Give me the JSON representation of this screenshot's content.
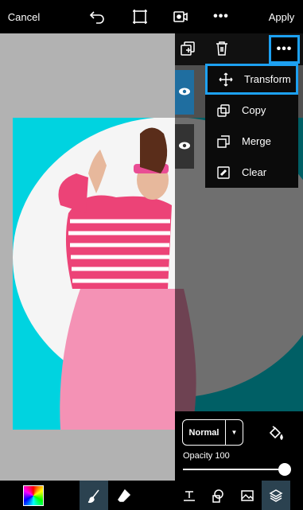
{
  "topbar": {
    "cancel_label": "Cancel",
    "apply_label": "Apply",
    "icons": [
      "undo-icon",
      "crop-icon",
      "video-record-icon",
      "more-horizontal-icon"
    ]
  },
  "layer_panel": {
    "toolbar_icons": [
      "duplicate-layer-icon",
      "delete-layer-icon",
      "more-icon"
    ],
    "menu": {
      "items": [
        {
          "label": "Transform",
          "icon": "transform-arrows-icon",
          "active": true
        },
        {
          "label": "Copy",
          "icon": "copy-icon",
          "active": false
        },
        {
          "label": "Merge",
          "icon": "merge-icon",
          "active": false
        },
        {
          "label": "Clear",
          "icon": "eraser-clear-icon",
          "active": false
        }
      ]
    },
    "blend_mode": "Normal",
    "opacity_label": "Opacity 100",
    "opacity_value": 100
  },
  "bottombar": {
    "tools": [
      "color-palette",
      "brush-icon",
      "eraser-icon",
      "text-icon",
      "shape-icon",
      "image-icon",
      "layers-icon"
    ],
    "selected_tool": "brush-icon",
    "selected_tab": "layers-icon"
  },
  "colors": {
    "accent": "#1da1f2",
    "canvas_bg": "#b2b2b2",
    "image_bg": "#00d3e0",
    "selected_tool_bg": "#2b4250"
  }
}
